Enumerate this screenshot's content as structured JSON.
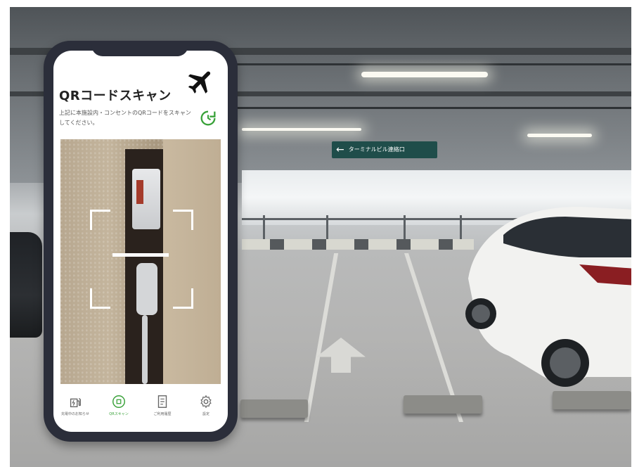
{
  "app": {
    "title": "QRコードスキャン",
    "description": "上記に本施設内・コンセントのQRコードをスキャンしてください。",
    "icons": {
      "header": "airplane-icon",
      "refresh": "refresh-icon"
    },
    "accent_color": "#3aa23a"
  },
  "tabs": [
    {
      "label": "充電中のお知らせ",
      "icon": "charging-station-icon",
      "active": false
    },
    {
      "label": "QRスキャン",
      "icon": "qr-scan-icon",
      "active": true
    },
    {
      "label": "ご利用履歴",
      "icon": "receipt-icon",
      "active": false
    },
    {
      "label": "設定",
      "icon": "gear-icon",
      "active": false
    }
  ],
  "background": {
    "sign_text": "ターミナルビル連絡口"
  }
}
